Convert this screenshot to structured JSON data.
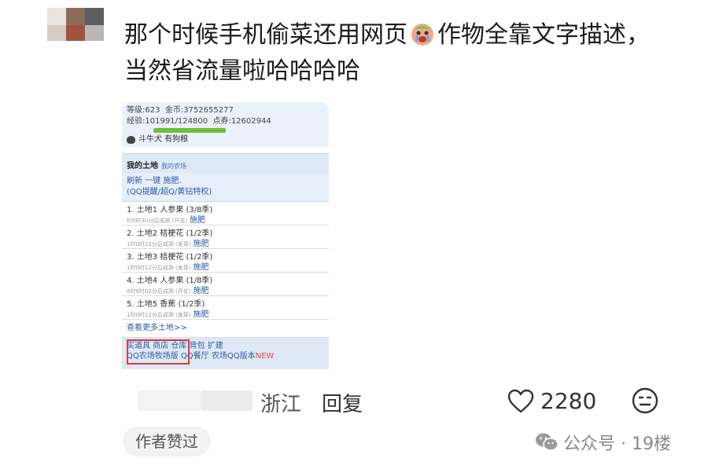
{
  "comment": {
    "line1_a": "那个时候手机偷菜还用网页",
    "line1_b": "作物全靠文字描述，",
    "line2": "当然省流量啦哈哈哈哈"
  },
  "farm": {
    "level": "等级:623",
    "coins": "金币:3752655277",
    "exp": "经验:101991/124800",
    "points": "点券:12602944",
    "pet": "斗牛犬 有狗粮",
    "my_land": "我的土地",
    "my_land_sub": "我的农场",
    "ops_line1": "刷新  一键 施肥.",
    "ops_line2": "(QQ提醒/超Q/黄钻特权)",
    "lands": [
      {
        "title": "1. 土地1 人参果 (3/8季)",
        "status": "约0时30分后成熟 (开花)",
        "action": "施肥"
      },
      {
        "title": "2. 土地2 桔梗花 (1/2季)",
        "status": "1时0时12分后成熟 (发芽)",
        "action": "施肥"
      },
      {
        "title": "3. 土地3 桔梗花 (1/2季)",
        "status": "1时0时12分后成熟 (发芽)",
        "action": "施肥"
      },
      {
        "title": "4. 土地4 人参果 (1/8季)",
        "status": "6时8时02分后成熟 (开花)",
        "action": "施肥"
      },
      {
        "title": "5. 土地5 香蕉 (1/2季)",
        "status": "1时0时12分后成熟 (发芽)",
        "action": "施肥"
      }
    ],
    "more_lands": "查看更多土地>>",
    "footer_line1": "买道具  商店  仓库  背包  扩建",
    "footer_line2_a": "QQ农场牧场版  QQ餐厅  农场QQ版本",
    "footer_line2_b": "NEW"
  },
  "meta": {
    "location": "浙江",
    "reply": "回复",
    "likes": "2280"
  },
  "badge": "作者赞过",
  "footer": {
    "source": "公众号 · 19楼"
  },
  "colors": {
    "like_stroke": "#333333",
    "highlight_box": "#d93b3b",
    "xp_bar": "#6cbf3a"
  }
}
